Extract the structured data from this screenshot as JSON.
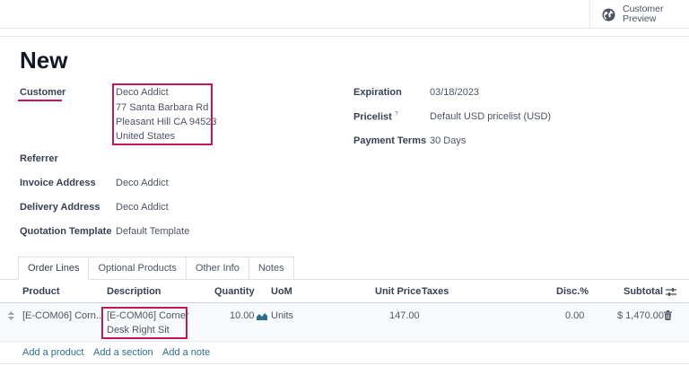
{
  "header": {
    "preview_line1": "Customer",
    "preview_line2": "Preview",
    "preview_icon": "globe-icon"
  },
  "form": {
    "title": "New",
    "customer": {
      "label": "Customer",
      "lines": [
        "Deco Addict",
        "77 Santa Barbara Rd",
        "Pleasant Hill CA 94523",
        "United States"
      ]
    },
    "referrer": {
      "label": "Referrer",
      "value": ""
    },
    "invoice_address": {
      "label": "Invoice Address",
      "value": "Deco Addict"
    },
    "delivery_address": {
      "label": "Delivery Address",
      "value": "Deco Addict"
    },
    "quotation_template": {
      "label": "Quotation Template",
      "value": "Default Template"
    },
    "expiration": {
      "label": "Expiration",
      "value": "03/18/2023"
    },
    "pricelist": {
      "label": "Pricelist",
      "help": "?",
      "value": "Default USD pricelist (USD)"
    },
    "payment_terms": {
      "label": "Payment Terms",
      "value": "30 Days"
    }
  },
  "tabs": [
    "Order Lines",
    "Optional Products",
    "Other Info",
    "Notes"
  ],
  "table": {
    "headers": {
      "product": "Product",
      "description": "Description",
      "quantity": "Quantity",
      "uom": "UoM",
      "unit_price": "Unit Price",
      "taxes": "Taxes",
      "disc": "Disc.%",
      "subtotal": "Subtotal"
    },
    "rows": [
      {
        "product": "[E-COM06] Corn...",
        "description_line1": "[E-COM06] Corner",
        "description_line2": "Desk Right Sit",
        "quantity": "10.00",
        "uom": "Units",
        "unit_price": "147.00",
        "taxes": "",
        "disc": "0.00",
        "subtotal": "$ 1,470.00"
      }
    ],
    "add_product": "Add a product",
    "add_section": "Add a section",
    "add_note": "Add a note"
  },
  "colors": {
    "highlight": "#c2185b",
    "link": "#2b6e8e"
  }
}
